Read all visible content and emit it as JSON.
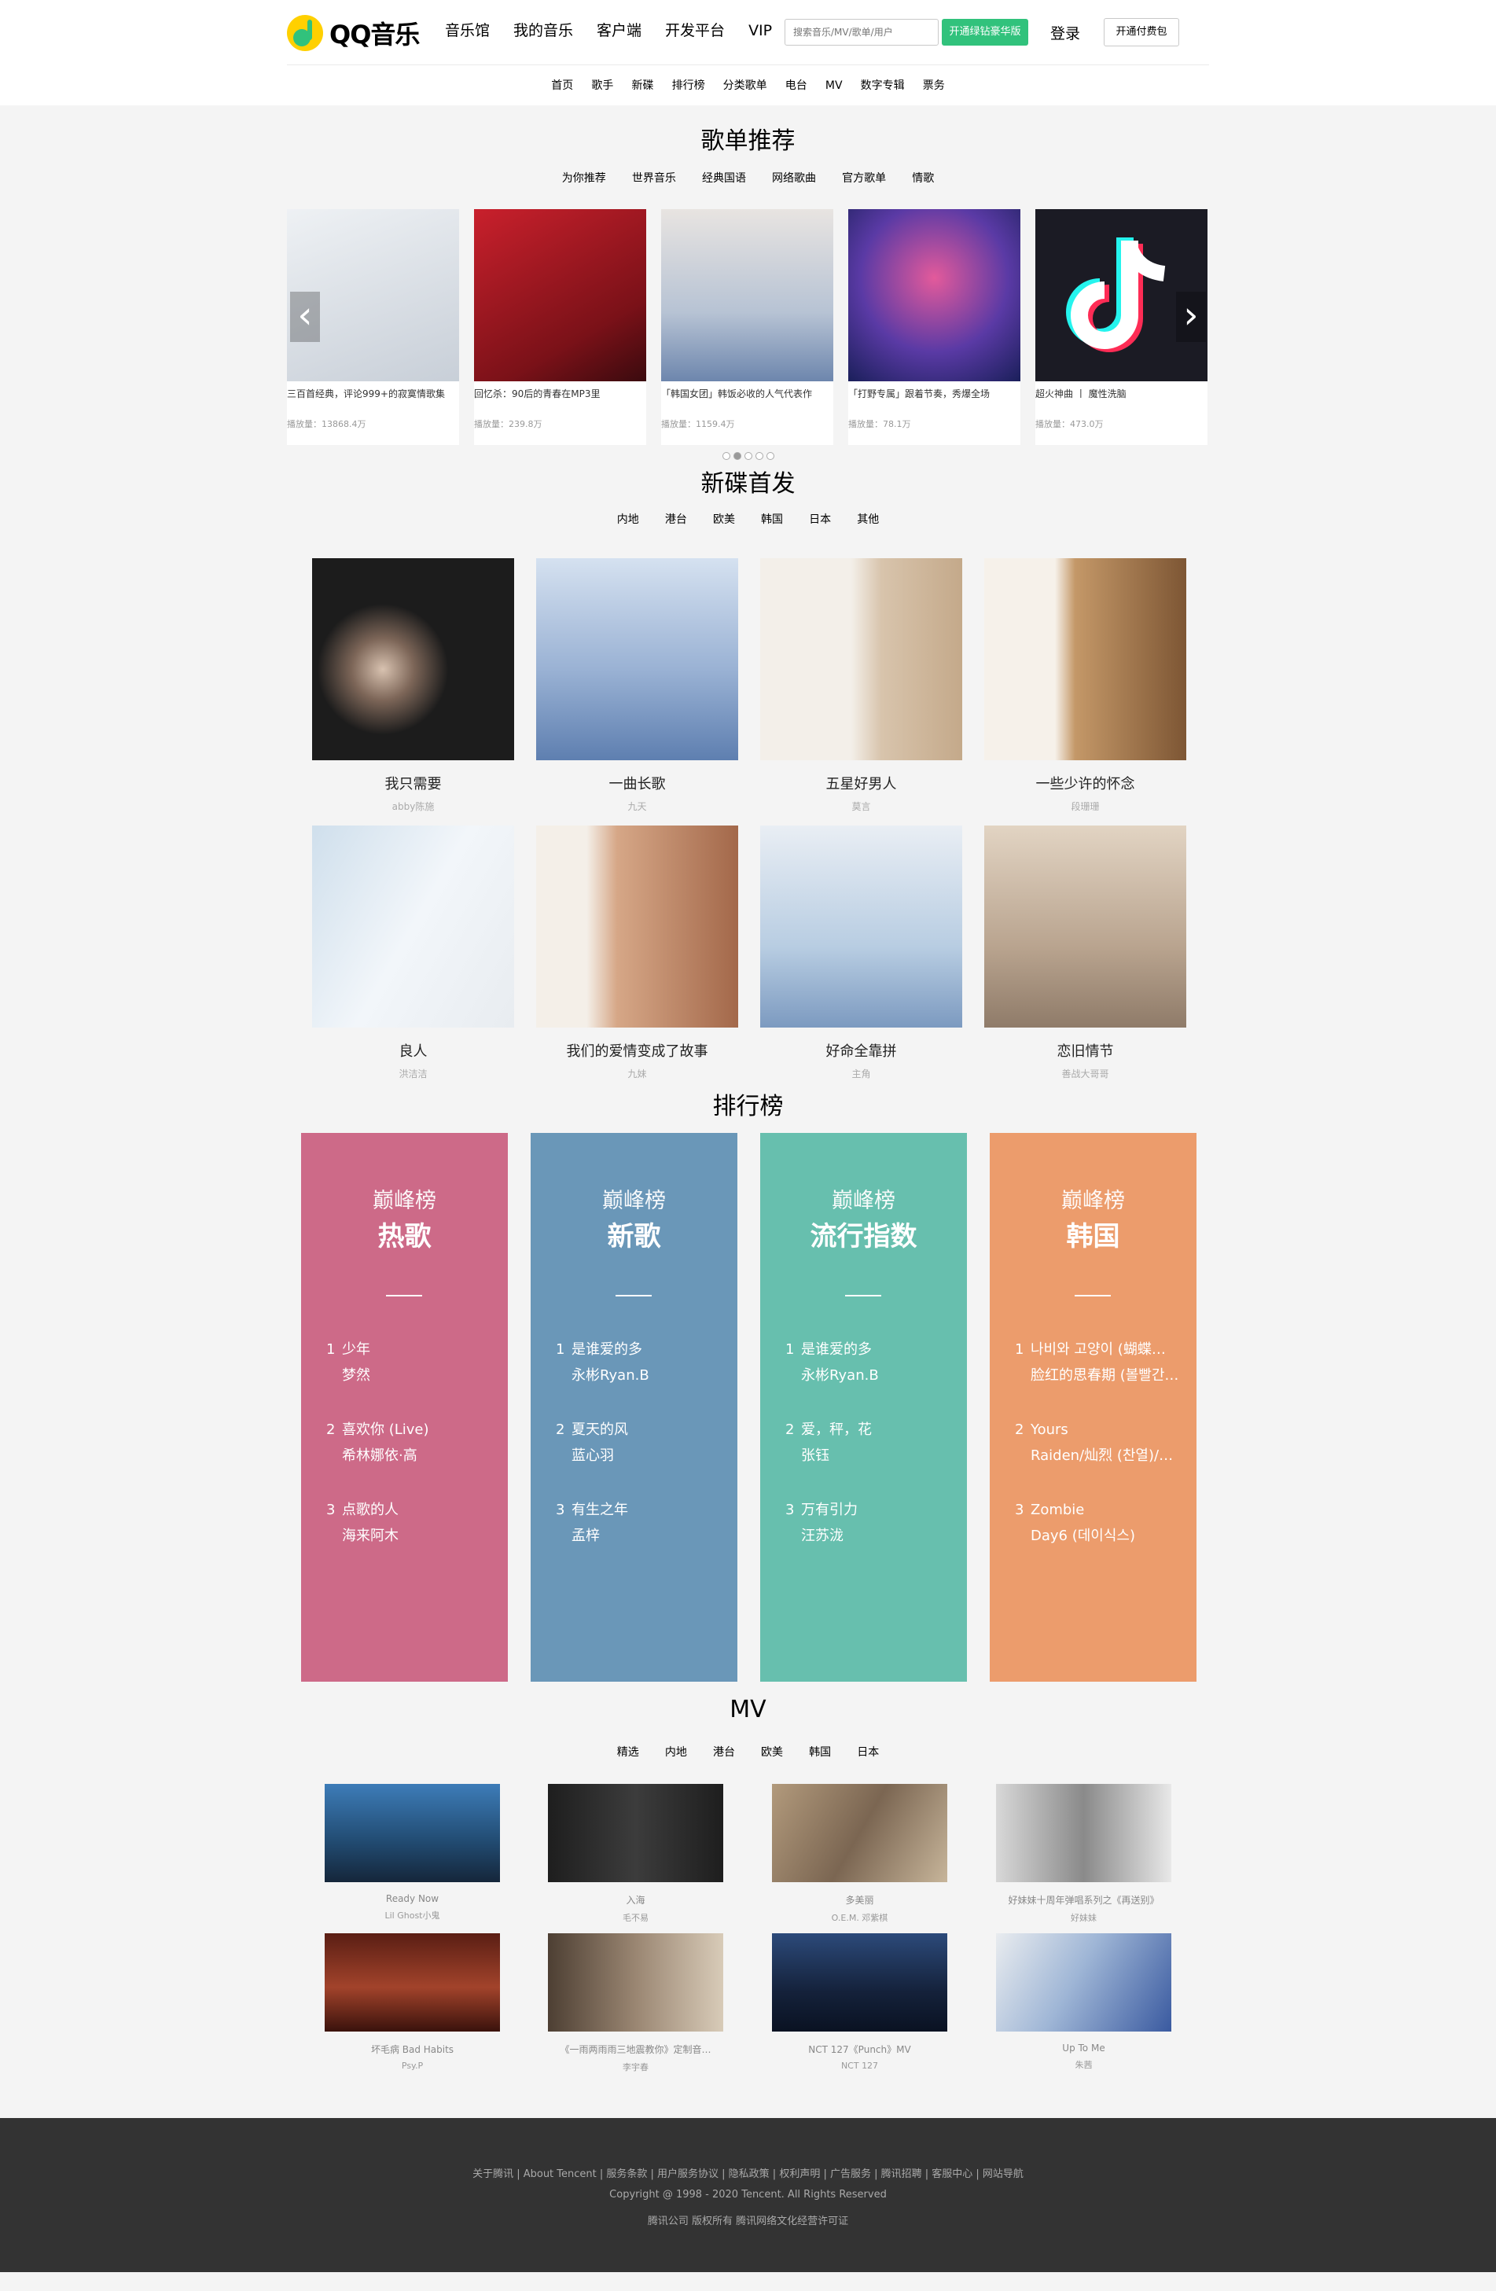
{
  "header": {
    "logo_text": "QQ音乐",
    "nav": [
      "音乐馆",
      "我的音乐",
      "客户端",
      "开发平台",
      "VIP"
    ],
    "search_placeholder": "搜索音乐/MV/歌单/用户",
    "green_button": "开通绿钻豪华版",
    "login": "登录",
    "outline_button": "开通付费包",
    "subnav": [
      "首页",
      "歌手",
      "新碟",
      "排行榜",
      "分类歌单",
      "电台",
      "MV",
      "数字专辑",
      "票务"
    ]
  },
  "playlists": {
    "title": "歌单推荐",
    "tabs": [
      "为你推荐",
      "世界音乐",
      "经典国语",
      "网络歌曲",
      "官方歌单",
      "情歌"
    ],
    "items": [
      {
        "title": "三百首经典，评论999+的寂寞情歌集",
        "count": "播放量：13868.4万",
        "color": "#d9dde3"
      },
      {
        "title": "回忆杀：90后的青春在MP3里",
        "count": "播放量：239.8万",
        "color": "#b9212b"
      },
      {
        "title": "「韩国女团」韩饭必收的人气代表作",
        "count": "播放量：1159.4万",
        "color": "#8aa0bc"
      },
      {
        "title": "「打野专属」跟着节奏，秀爆全场",
        "count": "播放量：78.1万",
        "color": "#3a4fa6"
      },
      {
        "title": "超火神曲 丨 魔性洗脑",
        "count": "播放量：473.0万",
        "color": "#1b1b24"
      }
    ],
    "dots": 5,
    "active_dot": 2
  },
  "albums": {
    "title": "新碟首发",
    "tabs": [
      "内地",
      "港台",
      "欧美",
      "韩国",
      "日本",
      "其他"
    ],
    "items": [
      {
        "name": "我只需要",
        "artist": "abby陈施",
        "color": "#1c1c1c"
      },
      {
        "name": "一曲长歌",
        "artist": "九天",
        "color": "#a7bbd8"
      },
      {
        "name": "五星好男人",
        "artist": "莫言",
        "color": "#e7ded5"
      },
      {
        "name": "一些少许的怀念",
        "artist": "段珊珊",
        "color": "#b28a5e"
      },
      {
        "name": "良人",
        "artist": "洪洁洁",
        "color": "#d6e4ef"
      },
      {
        "name": "我们的爱情变成了故事",
        "artist": "九妹",
        "color": "#e8d2c3"
      },
      {
        "name": "好命全靠拼",
        "artist": "主角",
        "color": "#a8c2da"
      },
      {
        "name": "恋旧情节",
        "artist": "善战大哥哥",
        "color": "#cbb8a3"
      }
    ]
  },
  "rankings": {
    "title": "排行榜",
    "items": [
      {
        "sub": "巅峰榜",
        "name": "热歌",
        "color": "#cd6a88",
        "songs": [
          {
            "n": "1",
            "song": "少年",
            "artist": "梦然"
          },
          {
            "n": "2",
            "song": "喜欢你 (Live)",
            "artist": "希林娜依·高"
          },
          {
            "n": "3",
            "song": "点歌的人",
            "artist": "海来阿木"
          }
        ]
      },
      {
        "sub": "巅峰榜",
        "name": "新歌",
        "color": "#6a97b8",
        "songs": [
          {
            "n": "1",
            "song": "是谁爱的多",
            "artist": "永彬Ryan.B"
          },
          {
            "n": "2",
            "song": "夏天的风",
            "artist": "蓝心羽"
          },
          {
            "n": "3",
            "song": "有生之年",
            "artist": "孟梓"
          }
        ]
      },
      {
        "sub": "巅峰榜",
        "name": "流行指数",
        "color": "#67bfae",
        "songs": [
          {
            "n": "1",
            "song": "是谁爱的多",
            "artist": "永彬Ryan.B"
          },
          {
            "n": "2",
            "song": "爱，秤，花",
            "artist": "张钰"
          },
          {
            "n": "3",
            "song": "万有引力",
            "artist": "汪苏泷"
          }
        ]
      },
      {
        "sub": "巅峰榜",
        "name": "韩国",
        "color": "#ec9c6c",
        "songs": [
          {
            "n": "1",
            "song": "나비와 고양이 (蝴蝶…",
            "artist": "脸红的思春期 (볼빨간…"
          },
          {
            "n": "2",
            "song": "Yours",
            "artist": "Raiden/灿烈 (찬열)/…"
          },
          {
            "n": "3",
            "song": "Zombie",
            "artist": "Day6 (데이식스)"
          }
        ]
      }
    ]
  },
  "mv": {
    "title": "MV",
    "tabs": [
      "精选",
      "内地",
      "港台",
      "欧美",
      "韩国",
      "日本"
    ],
    "items": [
      {
        "title": "Ready Now",
        "artist": "Lil Ghost小鬼",
        "color": "#2d5f8c"
      },
      {
        "title": "入海",
        "artist": "毛不易",
        "color": "#2a2a2a"
      },
      {
        "title": "多美丽",
        "artist": "O.E.M. 邓紫棋",
        "color": "#8c7a63"
      },
      {
        "title": "好妹妹十周年弹唱系列之《再送别》",
        "artist": "好妹妹",
        "color": "#b5b5b5"
      },
      {
        "title": "坏毛病 Bad Habits",
        "artist": "Psy.P",
        "color": "#7a2a1c"
      },
      {
        "title": "《一雨两雨雨三地震教你》定制音…",
        "artist": "李宇春",
        "color": "#6b5a4a"
      },
      {
        "title": "NCT 127《Punch》MV",
        "artist": "NCT 127",
        "color": "#1b2a4a"
      },
      {
        "title": "Up To Me",
        "artist": "朱茜",
        "color": "#4a6aa8"
      }
    ]
  },
  "footer": {
    "links": "关于腾讯 | About Tencent | 服务条款 | 用户服务协议 | 隐私政策 | 权利声明 | 广告服务 | 腾讯招聘 | 客服中心 | 网站导航",
    "copyright": "Copyright @ 1998 - 2020 Tencent. All Rights Reserved",
    "license": "腾讯公司 版权所有 腾讯网络文化经营许可证"
  }
}
